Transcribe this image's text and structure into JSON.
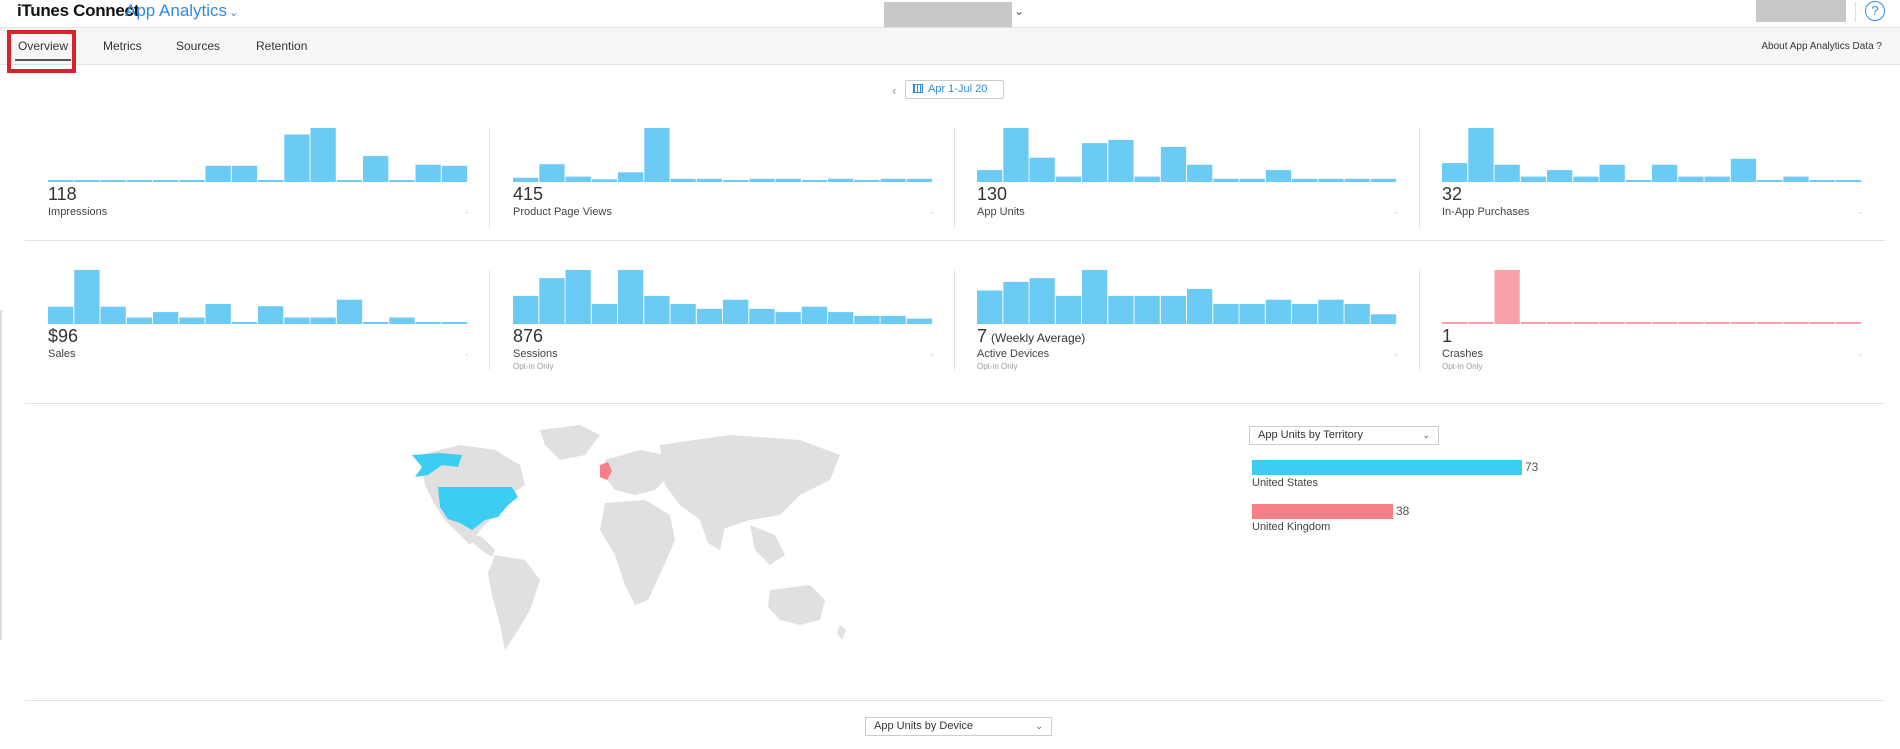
{
  "header": {
    "brand": "iTunes Connect",
    "product": "App Analytics",
    "help_symbol": "?"
  },
  "tabs": [
    "Overview",
    "Metrics",
    "Sources",
    "Retention"
  ],
  "active_tab": "Overview",
  "about_link": "About App Analytics Data ?",
  "date_range": "Apr 1-Jul 20",
  "colors": {
    "accent": "#2e8ce6",
    "bar": "#6ccbf4",
    "crash": "#f8a0a8",
    "us": "#3ccef2",
    "uk": "#f67f88",
    "highlight": "#d9232a"
  },
  "metrics": [
    {
      "value": "118",
      "suffix": "",
      "label": "Impressions",
      "sublabel": "",
      "color": "#6ccbf4",
      "bars": [
        0,
        0,
        0,
        0,
        0,
        0,
        0.3,
        0.3,
        0,
        0.88,
        1.0,
        0,
        0.48,
        0,
        0.32,
        0.3
      ]
    },
    {
      "value": "415",
      "suffix": "",
      "label": "Product Page Views",
      "sublabel": "",
      "color": "#6ccbf4",
      "bars": [
        0.08,
        0.33,
        0.1,
        0.05,
        0.18,
        1.0,
        0.06,
        0.06,
        0.03,
        0.06,
        0.06,
        0.03,
        0.06,
        0.03,
        0.06,
        0.06
      ]
    },
    {
      "value": "130",
      "suffix": "",
      "label": "App Units",
      "sublabel": "",
      "color": "#6ccbf4",
      "bars": [
        0.22,
        1.0,
        0.45,
        0.1,
        0.72,
        0.78,
        0.1,
        0.65,
        0.32,
        0.06,
        0.06,
        0.22,
        0.06,
        0.06,
        0.06,
        0.06
      ]
    },
    {
      "value": "32",
      "suffix": "",
      "label": "In-App Purchases",
      "sublabel": "",
      "color": "#6ccbf4",
      "bars": [
        0.35,
        1.0,
        0.32,
        0.1,
        0.22,
        0.1,
        0.32,
        0,
        0.32,
        0.1,
        0.1,
        0.43,
        0,
        0.1,
        0,
        0
      ]
    },
    {
      "value": "$96",
      "suffix": "",
      "label": "Sales",
      "sublabel": "",
      "color": "#6ccbf4",
      "bars": [
        0.32,
        1.0,
        0.32,
        0.12,
        0.22,
        0.12,
        0.37,
        0,
        0.33,
        0.12,
        0.12,
        0.45,
        0,
        0.12,
        0,
        0
      ]
    },
    {
      "value": "876",
      "suffix": "",
      "label": "Sessions",
      "sublabel": "Opt-in Only",
      "color": "#6ccbf4",
      "bars": [
        0.52,
        0.85,
        1.0,
        0.37,
        1.0,
        0.52,
        0.37,
        0.28,
        0.45,
        0.28,
        0.22,
        0.32,
        0.22,
        0.15,
        0.15,
        0.1
      ]
    },
    {
      "value": "7",
      "suffix": "(Weekly Average)",
      "label": "Active Devices",
      "sublabel": "Opt-in Only",
      "color": "#6ccbf4",
      "bars": [
        0.62,
        0.78,
        0.85,
        0.52,
        1.0,
        0.52,
        0.52,
        0.52,
        0.65,
        0.37,
        0.37,
        0.45,
        0.37,
        0.45,
        0.37,
        0.18
      ]
    },
    {
      "value": "1",
      "suffix": "",
      "label": "Crashes",
      "sublabel": "Opt-in Only",
      "color": "#f8a0a8",
      "bars": [
        0,
        0,
        1.0,
        0,
        0,
        0,
        0,
        0,
        0,
        0,
        0,
        0,
        0,
        0,
        0,
        0
      ]
    }
  ],
  "territory": {
    "select_label": "App Units by Territory",
    "items": [
      {
        "name": "United States",
        "value": 73,
        "color": "#3ccef2"
      },
      {
        "name": "United Kingdom",
        "value": 38,
        "color": "#f67f88"
      }
    ]
  },
  "device_select_label": "App Units by Device"
}
